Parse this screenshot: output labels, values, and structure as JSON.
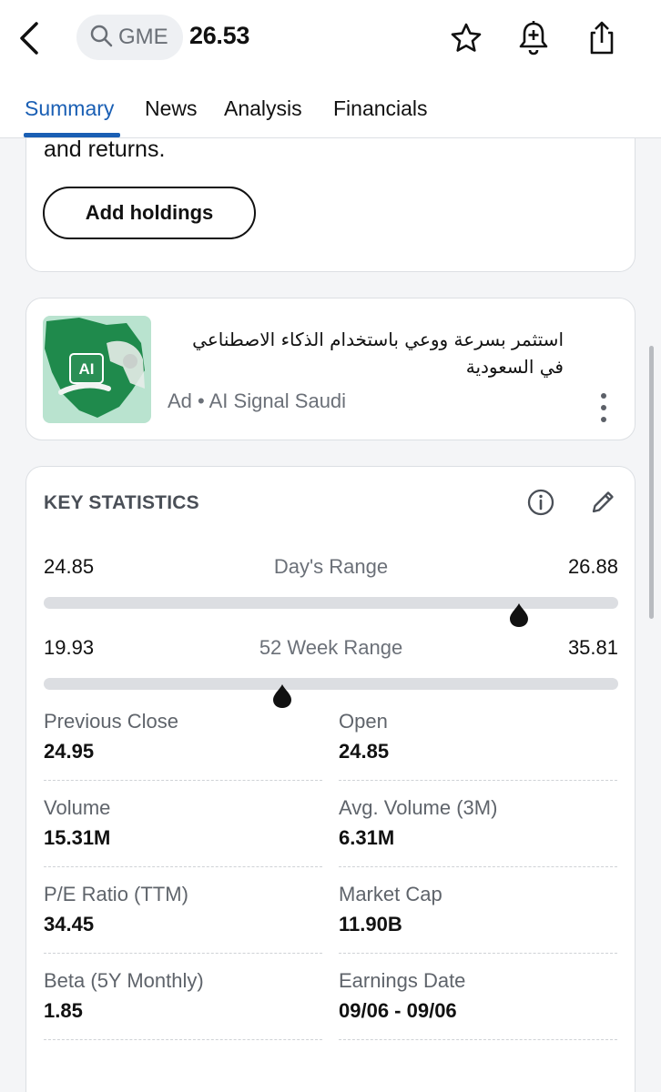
{
  "header": {
    "search_text": "GME",
    "price": "26.53"
  },
  "tabs": [
    {
      "label": "Summary",
      "active": true
    },
    {
      "label": "News",
      "active": false
    },
    {
      "label": "Analysis",
      "active": false
    },
    {
      "label": "Financials",
      "active": false
    }
  ],
  "holdings_card": {
    "text_fragment": "and returns.",
    "button_label": "Add holdings"
  },
  "ad": {
    "title": "استثمر بسرعة ووعي باستخدام الذكاء الاصطناعي في السعودية",
    "meta": "Ad • AI Signal Saudi",
    "image_text": "AI"
  },
  "key_statistics": {
    "title": "KEY STATISTICS",
    "days_range": {
      "low": "24.85",
      "label": "Day's Range",
      "high": "26.88",
      "current": 26.53
    },
    "week52_range": {
      "low": "19.93",
      "label": "52 Week Range",
      "high": "35.81",
      "current": 26.53
    },
    "stats": [
      {
        "label": "Previous Close",
        "value": "24.95"
      },
      {
        "label": "Open",
        "value": "24.85"
      },
      {
        "label": "Volume",
        "value": "15.31M"
      },
      {
        "label": "Avg. Volume (3M)",
        "value": "6.31M"
      },
      {
        "label": "P/E Ratio (TTM)",
        "value": "34.45"
      },
      {
        "label": "Market Cap",
        "value": "11.90B"
      },
      {
        "label": "Beta (5Y Monthly)",
        "value": "1.85"
      },
      {
        "label": "Earnings Date",
        "value": "09/06 - 09/06"
      }
    ]
  },
  "colors": {
    "accent": "#1a5fb4",
    "marker": "#111111",
    "track": "#dcdee2"
  }
}
